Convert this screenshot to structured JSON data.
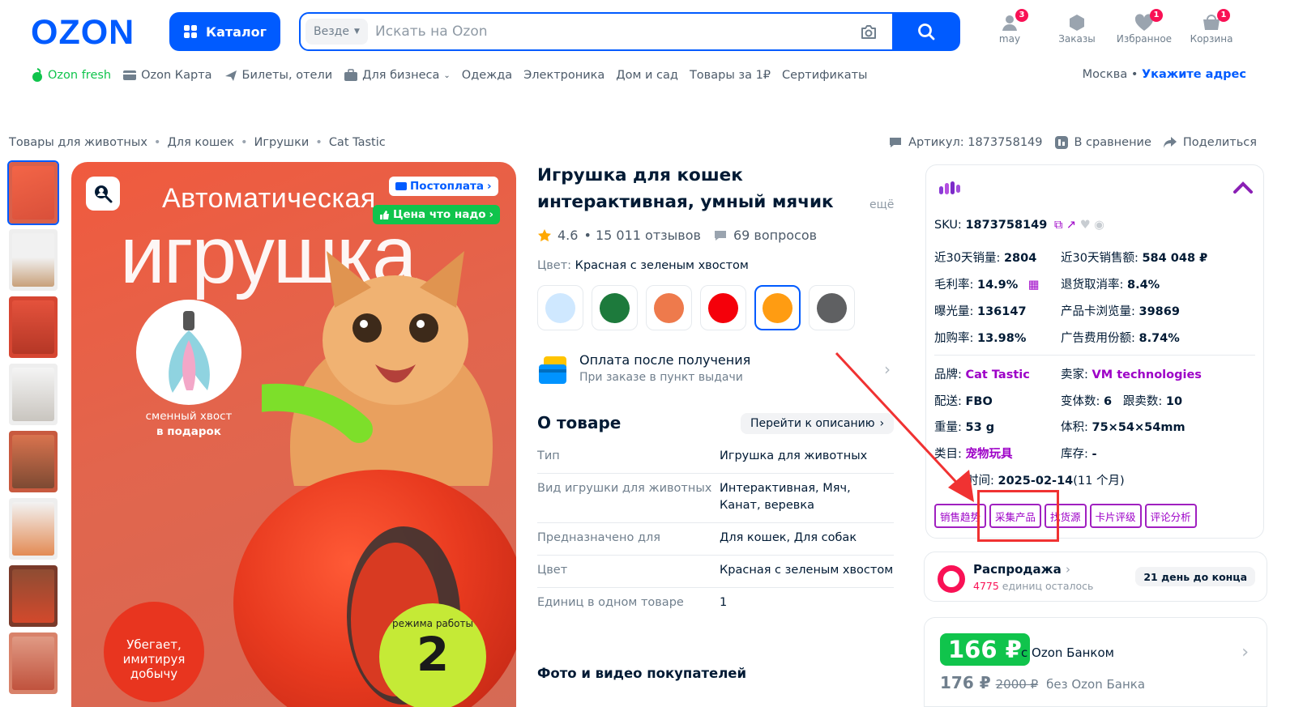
{
  "header": {
    "logo": "OZON",
    "catalog_label": "Каталог",
    "search": {
      "scope": "Везде",
      "placeholder": "Искать на Ozon"
    },
    "user": {
      "label": "may",
      "badge": "3"
    },
    "orders": {
      "label": "Заказы"
    },
    "favorites": {
      "label": "Избранное",
      "badge": "1"
    },
    "cart": {
      "label": "Корзина",
      "badge": "1"
    }
  },
  "nav": {
    "items": [
      "Ozon fresh",
      "Ozon Карта",
      "Билеты, отели",
      "Для бизнеса",
      "Одежда",
      "Электроника",
      "Дом и сад",
      "Товары за 1₽",
      "Сертификаты"
    ],
    "city": "Москва",
    "city_sep": "•",
    "address_link": "Укажите адрес"
  },
  "breadcrumb": [
    "Товары для животных",
    "Для кошек",
    "Игрушки",
    "Cat Tastic"
  ],
  "breadcrumb_sep": "•",
  "top_actions": {
    "article": "Артикул: 1873758149",
    "compare": "В сравнение",
    "share": "Поделиться"
  },
  "gallery": {
    "thumb_count": 8,
    "main_image": {
      "title_line1": "Автоматическая",
      "title_line2": "игрушка",
      "badge_postpay": "Постоплата",
      "badge_price": "Цена что надо",
      "gift_text_1": "сменный хвост",
      "gift_text_2": "в подарок",
      "runs_text_1": "Убегает,",
      "runs_text_2": "имитируя",
      "runs_text_3": "добычу",
      "modes_text": "режима работы",
      "modes_number": "2"
    }
  },
  "product": {
    "title": "Игрушка для кошек интерактивная, умный мячик",
    "more": "ещё",
    "rating": "4.6",
    "reviews": "• 15 011 отзывов",
    "questions": "69 вопросов",
    "color_label": "Цвет:",
    "color_value": "Красная с зеленым хвостом",
    "swatches": [
      "#cfe8ff",
      "#1d7a3c",
      "#ee7a4c",
      "#f5000a",
      "#ff9c12",
      "#5f6062"
    ],
    "payment_title": "Оплата после получения",
    "payment_sub": "При заказе в пункт выдачи",
    "about_title": "О товаре",
    "goto_desc": "Перейти к описанию",
    "specs": [
      {
        "k": "Тип",
        "v": "Игрушка для животных"
      },
      {
        "k": "Вид игрушки для животных",
        "v": "Интерактивная, Мяч, Канат, веревка"
      },
      {
        "k": "Предназначено для",
        "v": "Для кошек, Для собак"
      },
      {
        "k": "Цвет",
        "v": "Красная с зеленым хвостом"
      },
      {
        "k": "Единиц в одном товаре",
        "v": "1"
      }
    ],
    "ugc_title": "Фото и видео покупателей"
  },
  "extension": {
    "sku_label": "SKU:",
    "sku_value": "1873758149",
    "rows": {
      "sales30_label": "近30天销量:",
      "sales30_value": "2804",
      "revenue30_label": "近30天销售额:",
      "revenue30_value": "584 048 ₽",
      "margin_label": "毛利率:",
      "margin_value": "14.9%",
      "return_label": "退货取消率:",
      "return_value": "8.4%",
      "impr_label": "曝光量:",
      "impr_value": "136147",
      "views_label": "产品卡浏览量:",
      "views_value": "39869",
      "cart_rate_label": "加购率:",
      "cart_rate_value": "13.98%",
      "ad_label": "广告费用份额:",
      "ad_value": "8.74%",
      "brand_label": "品牌:",
      "brand_value": "Cat Tastic",
      "seller_label": "卖家:",
      "seller_value": "VM technologies",
      "delivery_label": "配送:",
      "delivery_value": "FBO",
      "variants_label": "变体数:",
      "variants_value": "6",
      "followers_label": "跟卖数:",
      "followers_value": "10",
      "weight_label": "重量:",
      "weight_value": "53 g",
      "volume_label": "体积:",
      "volume_value": "75×54×54mm",
      "category_label": "类目:",
      "category_value": "宠物玩具",
      "stock_label": "库存:",
      "stock_value": "-",
      "listed_label": "时间:",
      "listed_value": "2025-02-14",
      "listed_age": "(11 个月)"
    },
    "buttons": [
      "销售趋势",
      "采集产品",
      "找货源",
      "卡片评级",
      "评论分析"
    ]
  },
  "sale": {
    "title": "Распродажа",
    "count": "4775",
    "remaining": "единиц осталось",
    "days_left": "21 день до конца"
  },
  "price": {
    "main": "166 ₽",
    "bank": "с Ozon Банком",
    "without_bank": "176 ₽",
    "old": "2000 ₽",
    "without_bank_label": "без Ozon Банка"
  },
  "colors": {
    "brand": "#005bff",
    "green": "#10c44c",
    "pink": "#f91155",
    "ext_purple": "#9d00c7",
    "highlight_red": "#f03232"
  }
}
